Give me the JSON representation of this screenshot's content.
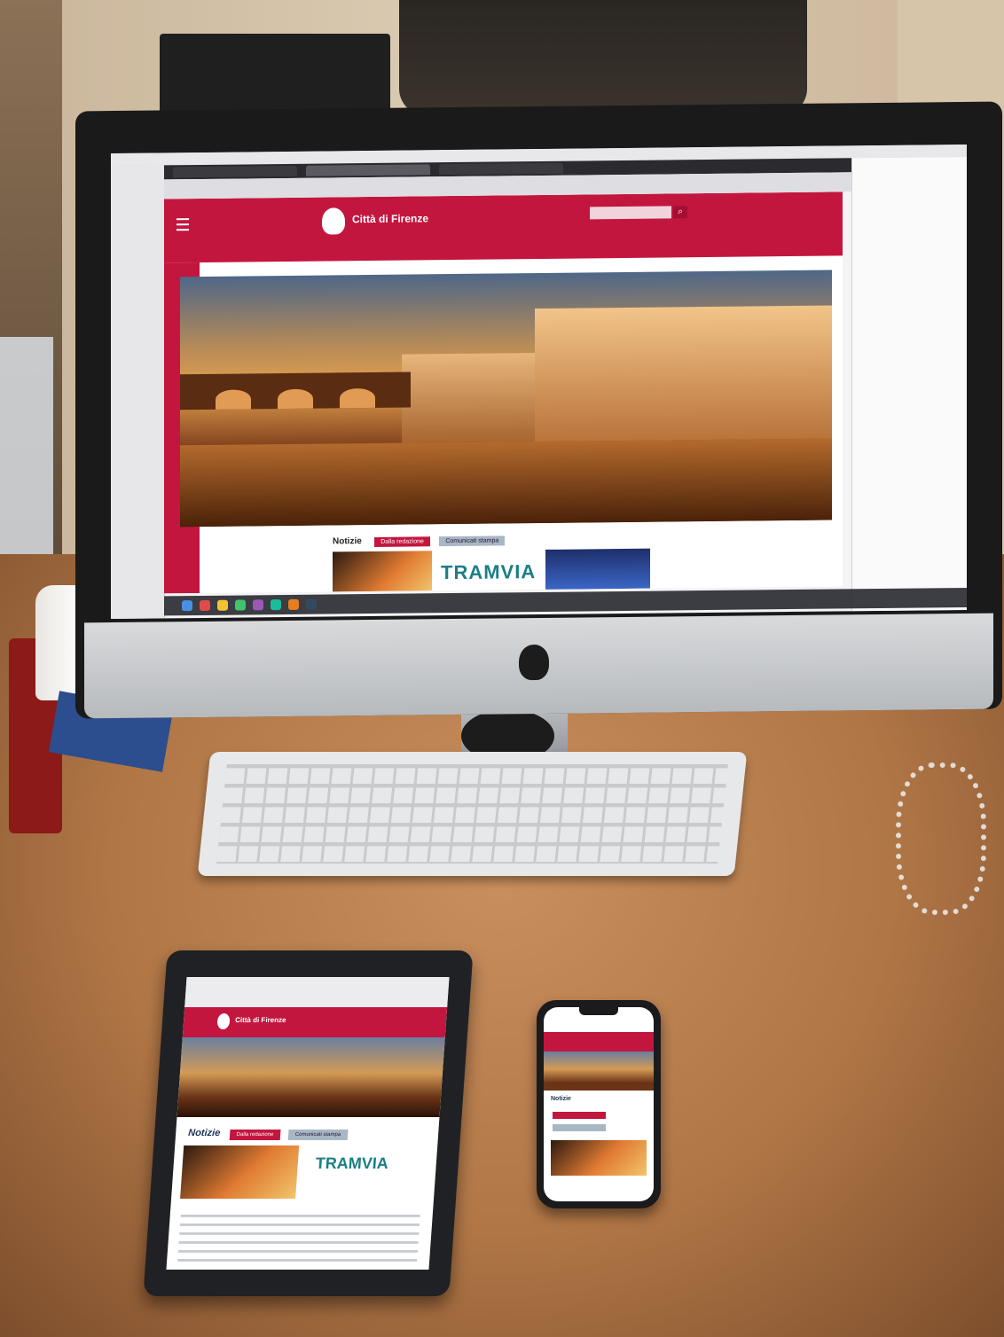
{
  "desktop": {
    "site_title": "Città di Firenze",
    "news_title": "Notizie",
    "pill_red": "Dalla redazione",
    "pill_grey": "Comunicati stampa",
    "promo_text": "TRAMVIA",
    "search_icon": "magnifier-icon"
  },
  "tablet": {
    "site_title": "Città di Firenze",
    "news_title": "Notizie",
    "pill_red": "Dalla redazione",
    "pill_grey": "Comunicati stampa",
    "promo_text": "TRAMVIA"
  },
  "phone": {
    "news_title": "Notizie"
  },
  "colors": {
    "brand_red": "#c3163f",
    "tramvia_teal": "#1b7f86",
    "desk_wood": "#b07646"
  }
}
